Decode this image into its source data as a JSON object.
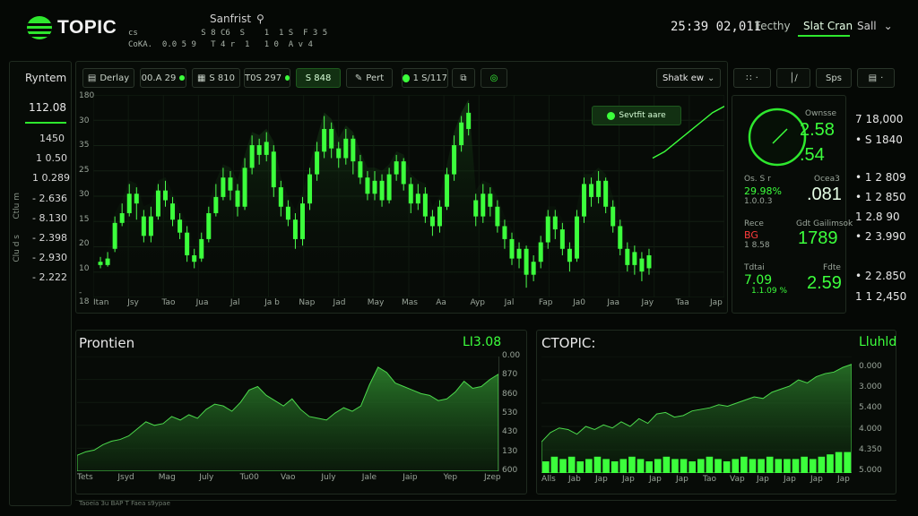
{
  "header": {
    "logo": "TOPIC",
    "search_label": "Sanfrist",
    "line1": "cs             S 8 C6  S    1  1 S  F 3 5",
    "line2": "CoKA.  0.0 5 9   T 4 r  1   1 0  A v 4",
    "time": "25:39 02,011",
    "nav_1": "Fecthy",
    "nav_2": "Slat Cran",
    "nav_3": "Sall"
  },
  "sidebar": {
    "title": "Ryntem",
    "active": "112.08",
    "values": [
      "1450",
      "1 0.50",
      "1 0.289",
      "- 2.636",
      "- 8.130",
      "- 2.398",
      "- 2.930",
      "- 2.222"
    ],
    "vert_1": "Ctlu m",
    "vert_2": "Clu d s"
  },
  "toolbar": {
    "b1": "Derlay",
    "b2": "00.A 29",
    "b3": "S 810",
    "b4": "T0S 297",
    "b5": "S 848",
    "b6": "Pert",
    "b7": "1 S/117",
    "select": "Shatk ew",
    "r2": "Sps"
  },
  "main_chart": {
    "yticks": [
      "180",
      "30",
      "35",
      "25",
      "30",
      "15",
      "20",
      "10",
      "- 18"
    ],
    "xticks": [
      "Itan",
      "Jsy",
      "Tao",
      "Jua",
      "Jal",
      "Ja b",
      "Nap",
      "Jad",
      "May",
      "Mas",
      "Aa",
      "Ayp",
      "Jal",
      "Fap",
      "Ja0",
      "Jaa",
      "Jay",
      "Taa",
      "Jap"
    ],
    "badge": "Sevtfit aare",
    "candles": [
      {
        "o": 22,
        "c": 20,
        "h": 25,
        "l": 18,
        "g": 1
      },
      {
        "o": 20,
        "c": 24,
        "h": 28,
        "l": 19,
        "g": 1
      },
      {
        "o": 30,
        "c": 46,
        "h": 50,
        "l": 28,
        "g": 1
      },
      {
        "o": 46,
        "c": 52,
        "h": 58,
        "l": 44,
        "g": 1
      },
      {
        "o": 52,
        "c": 64,
        "h": 70,
        "l": 50,
        "g": 1
      },
      {
        "o": 64,
        "c": 58,
        "h": 68,
        "l": 48,
        "g": 1
      },
      {
        "o": 50,
        "c": 38,
        "h": 54,
        "l": 34,
        "g": 1
      },
      {
        "o": 38,
        "c": 50,
        "h": 56,
        "l": 34,
        "g": 1
      },
      {
        "o": 50,
        "c": 66,
        "h": 70,
        "l": 48,
        "g": 1
      },
      {
        "o": 66,
        "c": 60,
        "h": 72,
        "l": 56,
        "g": 1
      },
      {
        "o": 58,
        "c": 48,
        "h": 62,
        "l": 44,
        "g": 1
      },
      {
        "o": 48,
        "c": 40,
        "h": 52,
        "l": 36,
        "g": 1
      },
      {
        "o": 40,
        "c": 26,
        "h": 44,
        "l": 22,
        "g": 1
      },
      {
        "o": 26,
        "c": 22,
        "h": 30,
        "l": 18,
        "g": 1
      },
      {
        "o": 24,
        "c": 36,
        "h": 40,
        "l": 22,
        "g": 1
      },
      {
        "o": 36,
        "c": 52,
        "h": 56,
        "l": 34,
        "g": 1
      },
      {
        "o": 52,
        "c": 62,
        "h": 70,
        "l": 50,
        "g": 1
      },
      {
        "o": 62,
        "c": 74,
        "h": 80,
        "l": 60,
        "g": 1
      },
      {
        "o": 74,
        "c": 66,
        "h": 78,
        "l": 60,
        "g": 1
      },
      {
        "o": 66,
        "c": 56,
        "h": 70,
        "l": 50,
        "g": 1
      },
      {
        "o": 56,
        "c": 80,
        "h": 86,
        "l": 54,
        "g": 1
      },
      {
        "o": 80,
        "c": 94,
        "h": 100,
        "l": 76,
        "g": 1
      },
      {
        "o": 94,
        "c": 88,
        "h": 98,
        "l": 82,
        "g": 1
      },
      {
        "o": 88,
        "c": 96,
        "h": 102,
        "l": 84,
        "g": 1
      },
      {
        "o": 90,
        "c": 68,
        "h": 94,
        "l": 62,
        "g": 1
      },
      {
        "o": 68,
        "c": 56,
        "h": 72,
        "l": 50,
        "g": 1
      },
      {
        "o": 56,
        "c": 48,
        "h": 60,
        "l": 44,
        "g": 1
      },
      {
        "o": 48,
        "c": 36,
        "h": 52,
        "l": 30,
        "g": 1
      },
      {
        "o": 36,
        "c": 58,
        "h": 62,
        "l": 32,
        "g": 1
      },
      {
        "o": 58,
        "c": 76,
        "h": 80,
        "l": 54,
        "g": 1
      },
      {
        "o": 76,
        "c": 90,
        "h": 96,
        "l": 72,
        "g": 1
      },
      {
        "o": 90,
        "c": 104,
        "h": 112,
        "l": 86,
        "g": 1
      },
      {
        "o": 104,
        "c": 92,
        "h": 108,
        "l": 86,
        "g": 1
      },
      {
        "o": 92,
        "c": 86,
        "h": 96,
        "l": 80,
        "g": 1
      },
      {
        "o": 86,
        "c": 98,
        "h": 104,
        "l": 82,
        "g": 1
      },
      {
        "o": 98,
        "c": 84,
        "h": 100,
        "l": 76,
        "g": 1
      },
      {
        "o": 84,
        "c": 74,
        "h": 88,
        "l": 70,
        "g": 1
      },
      {
        "o": 74,
        "c": 64,
        "h": 78,
        "l": 60,
        "g": 1
      },
      {
        "o": 64,
        "c": 72,
        "h": 78,
        "l": 60,
        "g": 1
      },
      {
        "o": 72,
        "c": 60,
        "h": 76,
        "l": 56,
        "g": 1
      },
      {
        "o": 60,
        "c": 76,
        "h": 80,
        "l": 58,
        "g": 1
      },
      {
        "o": 76,
        "c": 84,
        "h": 88,
        "l": 72,
        "g": 1
      },
      {
        "o": 84,
        "c": 70,
        "h": 86,
        "l": 66,
        "g": 1
      },
      {
        "o": 70,
        "c": 58,
        "h": 74,
        "l": 52,
        "g": 1
      },
      {
        "o": 58,
        "c": 64,
        "h": 70,
        "l": 54,
        "g": 1
      },
      {
        "o": 64,
        "c": 50,
        "h": 68,
        "l": 46,
        "g": 1
      },
      {
        "o": 50,
        "c": 44,
        "h": 54,
        "l": 38,
        "g": 1
      },
      {
        "o": 44,
        "c": 56,
        "h": 60,
        "l": 40,
        "g": 1
      },
      {
        "o": 56,
        "c": 76,
        "h": 80,
        "l": 54,
        "g": 1
      },
      {
        "o": 76,
        "c": 94,
        "h": 100,
        "l": 72,
        "g": 1
      },
      {
        "o": 94,
        "c": 108,
        "h": 112,
        "l": 90,
        "g": 1
      },
      {
        "o": 104,
        "c": 114,
        "h": 120,
        "l": 100,
        "g": 1
      },
      {
        "o": 60,
        "c": 50,
        "h": 64,
        "l": 44,
        "g": 1
      },
      {
        "o": 50,
        "c": 64,
        "h": 70,
        "l": 46,
        "g": 1
      },
      {
        "o": 64,
        "c": 56,
        "h": 68,
        "l": 50,
        "g": 1
      },
      {
        "o": 56,
        "c": 44,
        "h": 60,
        "l": 40,
        "g": 1
      },
      {
        "o": 44,
        "c": 36,
        "h": 48,
        "l": 30,
        "g": 1
      },
      {
        "o": 36,
        "c": 24,
        "h": 40,
        "l": 20,
        "g": 1
      },
      {
        "o": 24,
        "c": 30,
        "h": 34,
        "l": 18,
        "g": 1
      },
      {
        "o": 30,
        "c": 14,
        "h": 32,
        "l": 6,
        "g": 1
      },
      {
        "o": 14,
        "c": 22,
        "h": 26,
        "l": 10,
        "g": 1
      },
      {
        "o": 22,
        "c": 34,
        "h": 38,
        "l": 18,
        "g": 1
      },
      {
        "o": 34,
        "c": 50,
        "h": 54,
        "l": 30,
        "g": 1
      },
      {
        "o": 50,
        "c": 42,
        "h": 54,
        "l": 36,
        "g": 1
      },
      {
        "o": 42,
        "c": 30,
        "h": 46,
        "l": 26,
        "g": 1
      },
      {
        "o": 30,
        "c": 22,
        "h": 34,
        "l": 16,
        "g": 1
      },
      {
        "o": 24,
        "c": 50,
        "h": 54,
        "l": 22,
        "g": 1
      },
      {
        "o": 50,
        "c": 70,
        "h": 74,
        "l": 46,
        "g": 1
      },
      {
        "o": 70,
        "c": 62,
        "h": 74,
        "l": 56,
        "g": 1
      },
      {
        "o": 62,
        "c": 72,
        "h": 78,
        "l": 58,
        "g": 1
      },
      {
        "o": 72,
        "c": 56,
        "h": 74,
        "l": 52,
        "g": 1
      },
      {
        "o": 56,
        "c": 44,
        "h": 60,
        "l": 40,
        "g": 1
      },
      {
        "o": 44,
        "c": 30,
        "h": 48,
        "l": 26,
        "g": 1
      },
      {
        "o": 30,
        "c": 20,
        "h": 34,
        "l": 16,
        "g": 1
      },
      {
        "o": 20,
        "c": 28,
        "h": 32,
        "l": 14,
        "g": 1
      },
      {
        "o": 24,
        "c": 16,
        "h": 28,
        "l": 10,
        "g": 1
      },
      {
        "o": 18,
        "c": 26,
        "h": 30,
        "l": 14,
        "g": 1
      }
    ],
    "trend": [
      26,
      30,
      36,
      42,
      48,
      54,
      58
    ]
  },
  "right_panel": {
    "gauge_label": "Ownsse",
    "gauge_val1": "2.58",
    "gauge_val2": ".54",
    "l1": "Os. S r",
    "l1v": "Ocea3",
    "l2": "29.98%",
    "l2b": "1.0.0.3",
    "l2v": ".081",
    "l3": "Rece",
    "l3v": "Gdt Gailimsok",
    "l4": "BG",
    "l4b": "1 8.58",
    "l4v": "1789",
    "l5": "Tdtai",
    "l5v": "Fdte",
    "l6": "7.09",
    "l6b": "1.1.09 %",
    "l6v": "2.59",
    "col": [
      "7 18,000",
      "• S 1840",
      "• 1 2 809",
      "• 1 2 850",
      "1 2.8 90",
      "• 2 3.990",
      "• 2 2.850",
      "1 1 2,450"
    ]
  },
  "bottom_left": {
    "title": "Prontien",
    "value": "LI3.08",
    "yticks": [
      "0.00",
      "870",
      "860",
      "530",
      "430",
      "130",
      "600"
    ],
    "xticks": [
      "Tets",
      "Jsyd",
      "Mag",
      "July",
      "Tu00",
      "Vao",
      "July",
      "Jale",
      "Jaip",
      "Yep",
      "Jzep"
    ],
    "series": [
      18,
      22,
      24,
      30,
      34,
      36,
      40,
      48,
      56,
      52,
      54,
      62,
      58,
      64,
      60,
      70,
      76,
      74,
      68,
      78,
      92,
      96,
      86,
      80,
      74,
      82,
      70,
      62,
      60,
      58,
      66,
      72,
      68,
      74,
      98,
      118,
      112,
      100,
      96,
      92,
      88,
      86,
      80,
      82,
      90,
      102,
      94,
      96,
      104,
      110
    ]
  },
  "bottom_right": {
    "title": "CTOPIC:",
    "value": "Lluhld",
    "yticks": [
      "0.000",
      "3.000",
      "5.400",
      "4.000",
      "4.350",
      "5.000"
    ],
    "xticks": [
      "Alls",
      "Jab",
      "Jap",
      "Jap",
      "Jap",
      "Jap",
      "Tao",
      "Vap",
      "Jap",
      "Jap",
      "Jap",
      "Jap"
    ],
    "series": [
      40,
      52,
      58,
      56,
      50,
      60,
      56,
      62,
      58,
      66,
      60,
      70,
      64,
      76,
      78,
      72,
      74,
      80,
      82,
      84,
      88,
      86,
      90,
      94,
      98,
      96,
      104,
      108,
      112,
      120,
      116,
      124,
      128,
      130,
      136,
      140
    ],
    "bars": [
      10,
      14,
      12,
      14,
      10,
      12,
      14,
      12,
      10,
      12,
      14,
      12,
      10,
      12,
      14,
      12,
      12,
      10,
      12,
      14,
      12,
      10,
      12,
      14,
      12,
      12,
      14,
      12,
      12,
      12,
      14,
      12,
      14,
      16,
      18,
      18
    ],
    "footer": "Taoeia 3u BAP  T Faea s9ypae"
  },
  "colors": {
    "accent": "#3cff3c",
    "bg": "#050805",
    "red": "#ff3c3c"
  }
}
